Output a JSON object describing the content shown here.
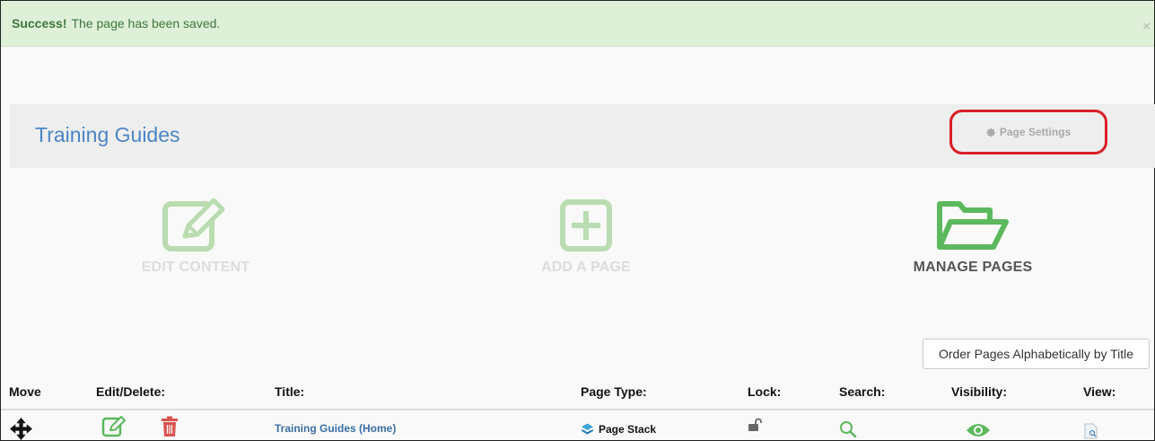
{
  "alert": {
    "strong": "Success!",
    "message": "The page has been saved.",
    "close": "×"
  },
  "header": {
    "title": "Training Guides",
    "settings_label": "Page Settings"
  },
  "actions": {
    "edit_content": "EDIT CONTENT",
    "add_page": "ADD A PAGE",
    "manage_pages": "MANAGE PAGES"
  },
  "order_button": "Order Pages Alphabetically by Title",
  "table": {
    "columns": {
      "move": "Move",
      "edit_delete": "Edit/Delete:",
      "title": "Title:",
      "page_type": "Page Type:",
      "lock": "Lock:",
      "search": "Search:",
      "visibility": "Visibility:",
      "view": "View:"
    },
    "rows": [
      {
        "title": "Training Guides (Home)",
        "page_type": "Page Stack"
      }
    ]
  },
  "colors": {
    "accent_green": "#5cb85c",
    "faded_green": "#b9dcb0",
    "title_blue": "#4a86c5",
    "highlight_red": "#d92026",
    "delete_red": "#d9534f"
  },
  "icons": [
    "close-icon",
    "gear-icon",
    "edit-icon",
    "add-icon",
    "folder-open-icon",
    "move-icon",
    "pencil-square-icon",
    "trash-icon",
    "layers-icon",
    "unlock-icon",
    "search-icon",
    "eye-icon",
    "file-preview-icon"
  ]
}
